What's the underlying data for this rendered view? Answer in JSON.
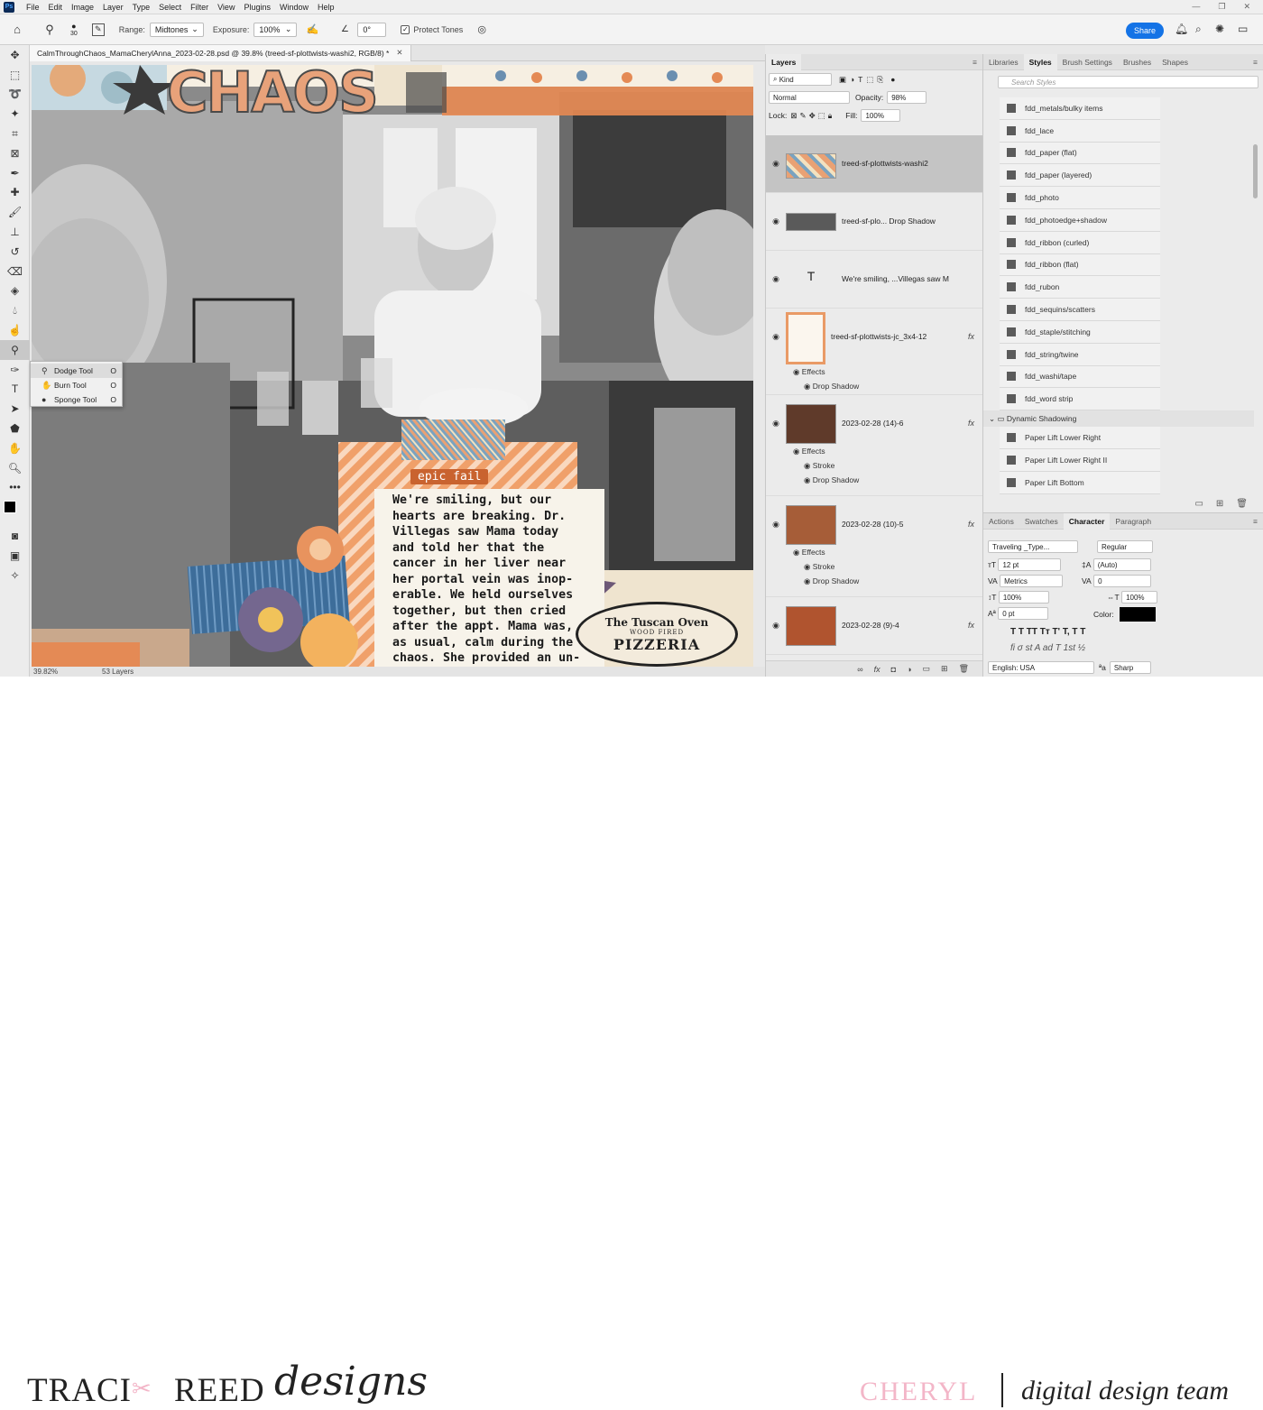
{
  "menubar": {
    "logo": "Ps",
    "items": [
      "File",
      "Edit",
      "Image",
      "Layer",
      "Type",
      "Select",
      "Filter",
      "View",
      "Plugins",
      "Window",
      "Help"
    ]
  },
  "options": {
    "brush_size": "30",
    "range_label": "Range:",
    "range_value": "Midtones",
    "exposure_label": "Exposure:",
    "exposure_value": "100%",
    "angle_value": "0°",
    "protect_tones": "Protect Tones",
    "share": "Share"
  },
  "document": {
    "tab_title": "CalmThroughChaos_MamaCherylAnna_2023-02-28.psd @ 39.8% (treed-sf-plottwists-washi2, RGB/8) *",
    "zoom": "39.82%",
    "layers_count": "53 Layers",
    "epic_fail": "epic fail",
    "story": "We're smiling, but our\nhearts are breaking. Dr.\nVillegas saw Mama today\nand told her that the\ncancer in her liver near\nher portal vein was inop-\nerable. We held ourselves\ntogether, but then cried\nafter the appt. Mama was,\nas usual, calm during the\nchaos. She provided an un-",
    "title_art": "CHAOS",
    "stamp_line1": "The Tuscan Oven",
    "stamp_line2": "WOOD  FIRED",
    "stamp_line3": "PIZZERIA"
  },
  "flyout": {
    "items": [
      {
        "label": "Dodge Tool",
        "key": "O"
      },
      {
        "label": "Burn Tool",
        "key": "O"
      },
      {
        "label": "Sponge Tool",
        "key": "O"
      }
    ]
  },
  "layers_panel": {
    "tab": "Layers",
    "kind": "Kind",
    "blend_mode": "Normal",
    "opacity_label": "Opacity:",
    "opacity_value": "98%",
    "lock_label": "Lock:",
    "fill_label": "Fill:",
    "fill_value": "100%",
    "layers": [
      {
        "name": "treed-sf-plottwists-washi2",
        "fx": ""
      },
      {
        "name": "treed-sf-plo... Drop Shadow",
        "fx": ""
      },
      {
        "name": "We're smiling, ...Villegas saw M",
        "fx": ""
      },
      {
        "name": "treed-sf-plottwists-jc_3x4-12",
        "fx": "fx"
      },
      {
        "name": "2023-02-28 (14)-6",
        "fx": "fx"
      },
      {
        "name": "2023-02-28 (10)-5",
        "fx": "fx"
      },
      {
        "name": "2023-02-28 (9)-4",
        "fx": "fx"
      }
    ],
    "effects_label": "Effects",
    "drop_shadow": "Drop Shadow",
    "stroke": "Stroke",
    "type_glyph": "T"
  },
  "styles_panel": {
    "tabs": [
      "Libraries",
      "Styles",
      "Brush Settings",
      "Brushes",
      "Shapes"
    ],
    "search_placeholder": "Search Styles",
    "items": [
      "fdd_metals/bulky items",
      "fdd_lace",
      "fdd_paper (flat)",
      "fdd_paper (layered)",
      "fdd_photo",
      "fdd_photoedge+shadow",
      "fdd_ribbon (curled)",
      "fdd_ribbon (flat)",
      "fdd_rubon",
      "fdd_sequins/scatters",
      "fdd_staple/stitching",
      "fdd_string/twine",
      "fdd_washi/tape",
      "fdd_word strip"
    ],
    "folder": "Dynamic Shadowing",
    "folder_items": [
      "Paper Lift Lower Right",
      "Paper Lift Lower Right II",
      "Paper Lift Bottom"
    ]
  },
  "character_panel": {
    "tabs": [
      "Actions",
      "Swatches",
      "Character",
      "Paragraph"
    ],
    "font": "Traveling _Type...",
    "style": "Regular",
    "size": "12 pt",
    "leading": "(Auto)",
    "kerning": "Metrics",
    "tracking": "0",
    "vscale": "100%",
    "hscale": "100%",
    "baseline": "0 pt",
    "color_label": "Color:",
    "language": "English: USA",
    "antialias": "Sharp",
    "aa_label": "ªa",
    "type_styles": "T  T  TT  Tт  T'  T,  T  T",
    "opentype": "fi  σ  st  A  ad  T  1st  ½"
  },
  "footer": {
    "brand_a": "TRACI",
    "brand_b": "REED",
    "brand_script": "designs",
    "name": "CHERYL",
    "team": "digital design team"
  },
  "colors": {
    "accent": "#1473e6",
    "epic_fail": "#c9632f",
    "cheryl_pink": "#f3b6c8"
  }
}
